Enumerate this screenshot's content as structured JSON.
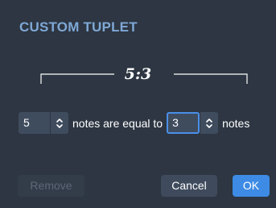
{
  "dialog": {
    "title": "CUSTOM TUPLET"
  },
  "bracket": {
    "ratio_label": "5:3"
  },
  "tuplet": {
    "actual_notes_value": "5",
    "text_middle": "notes are equal to",
    "normal_notes_value": "3",
    "text_end": "notes"
  },
  "buttons": {
    "remove_label": "Remove",
    "cancel_label": "Cancel",
    "ok_label": "OK"
  },
  "icons": {
    "stepper": "chevron-up-down-icon"
  },
  "colors": {
    "background": "#2d3642",
    "title": "#7fa8d6",
    "accent": "#3d8be5",
    "field": "#3f4c5e"
  }
}
